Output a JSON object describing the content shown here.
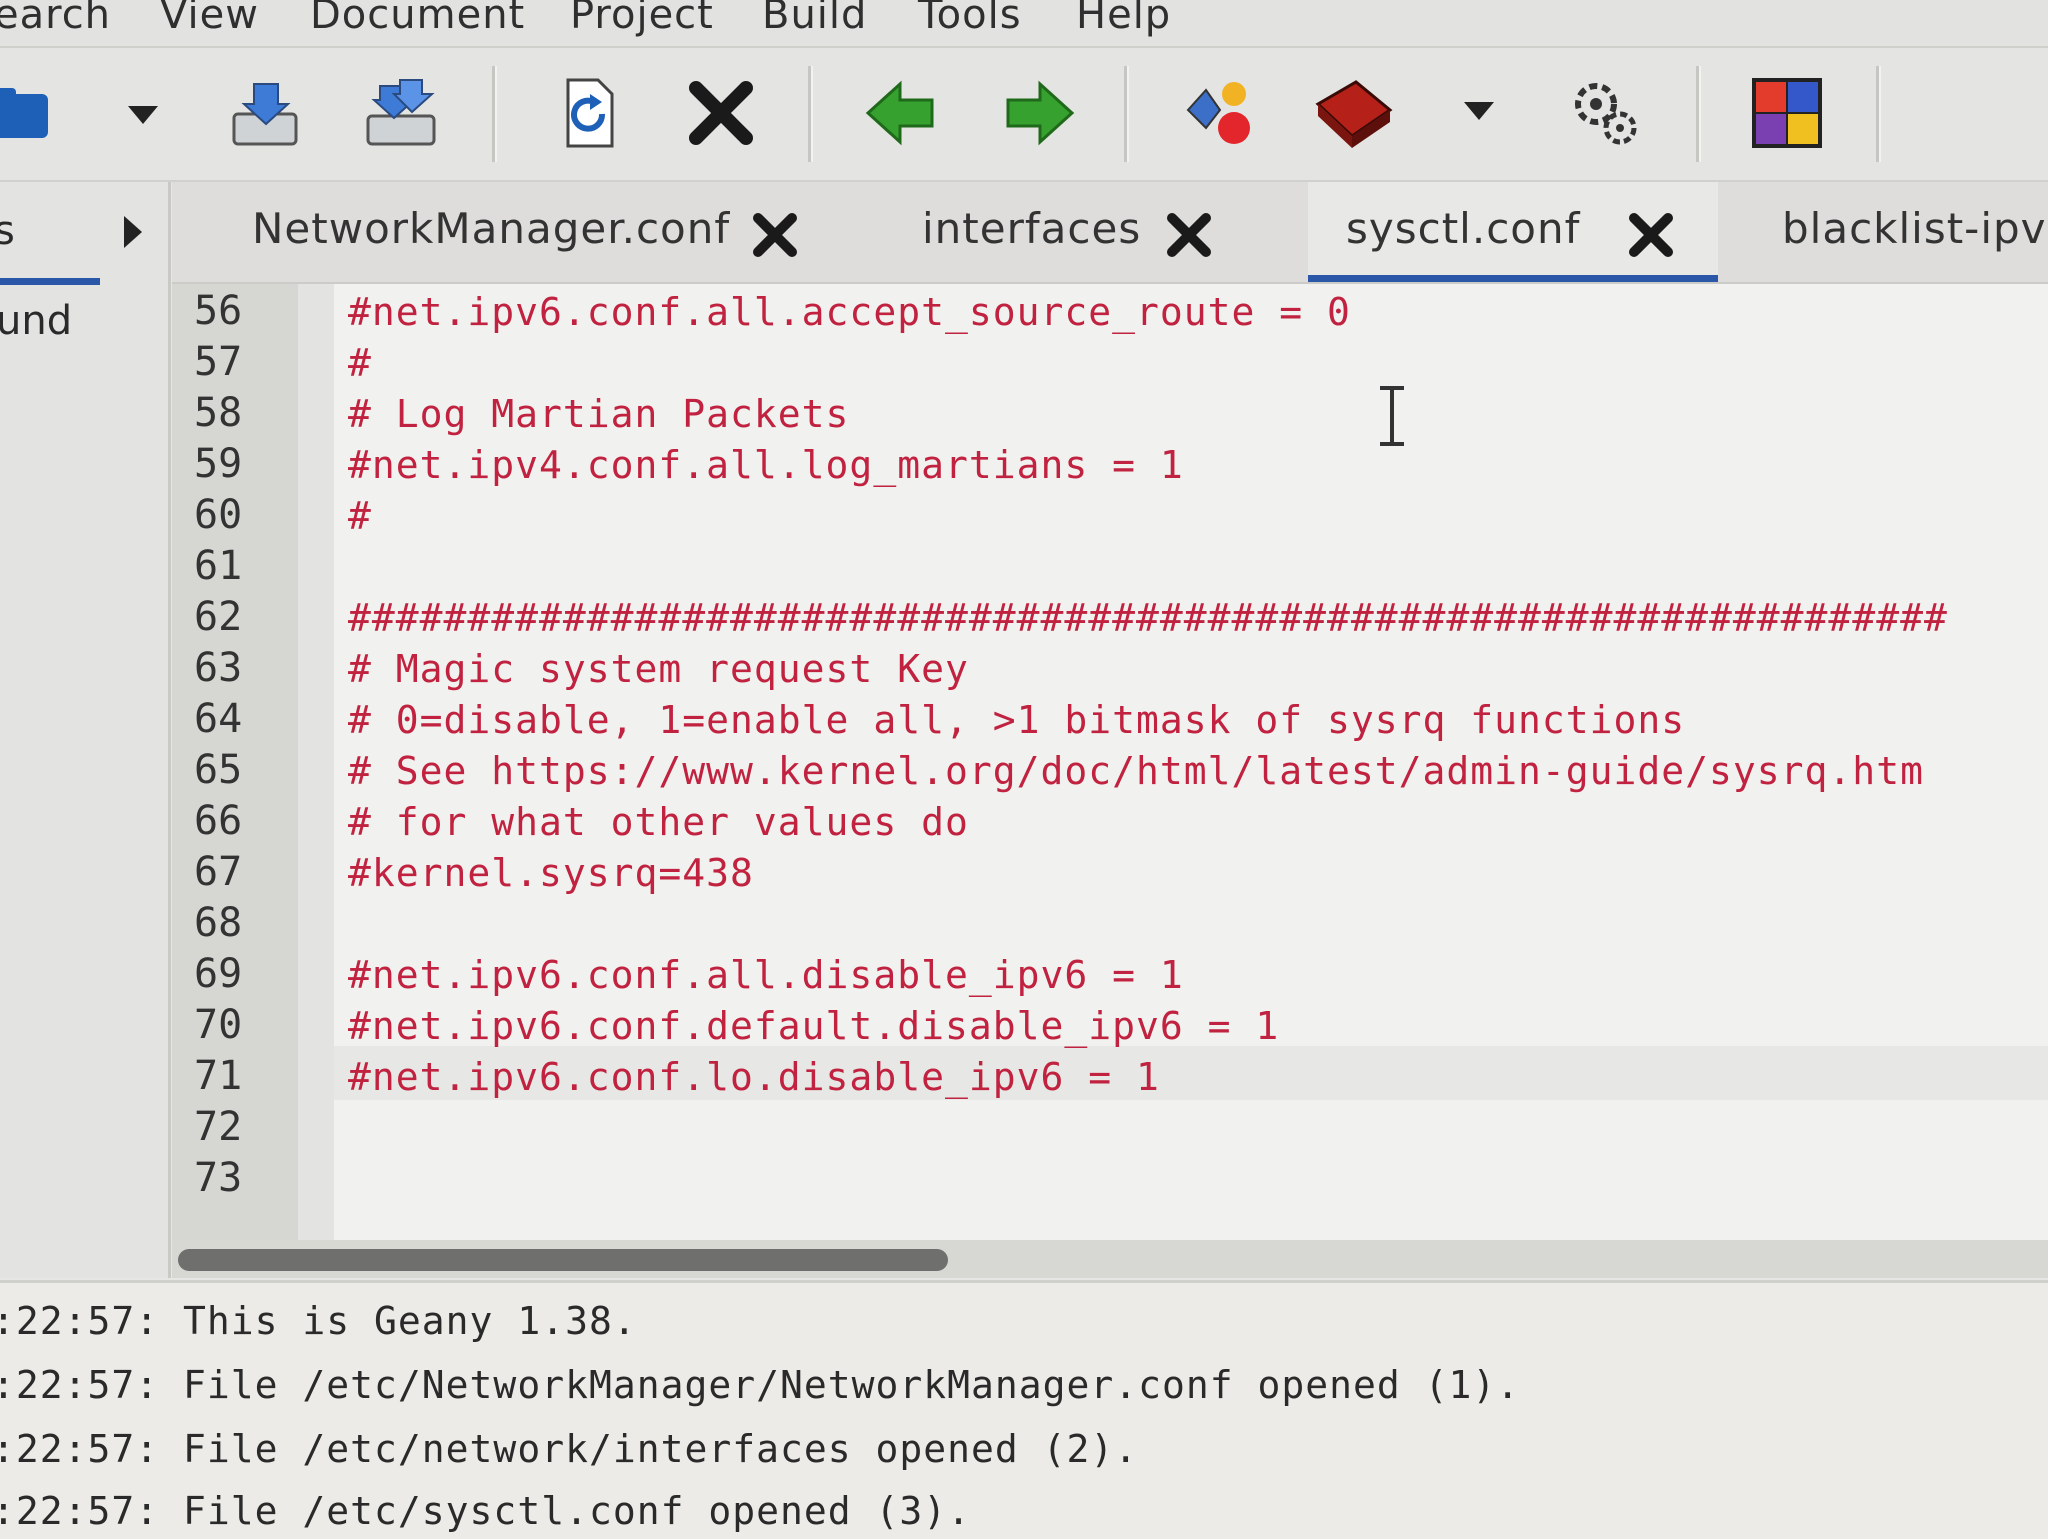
{
  "menubar": {
    "items": [
      "earch",
      "View",
      "Document",
      "Project",
      "Build",
      "Tools",
      "Help"
    ]
  },
  "toolbar": {
    "buttons": [
      {
        "name": "open-icon"
      },
      {
        "name": "dropdown-icon"
      },
      {
        "name": "save-icon"
      },
      {
        "name": "save-all-icon"
      },
      {
        "name": "reload-icon"
      },
      {
        "name": "close-icon"
      },
      {
        "name": "back-icon"
      },
      {
        "name": "forward-icon"
      },
      {
        "name": "compile-icon"
      },
      {
        "name": "build-icon"
      },
      {
        "name": "build-dropdown-icon"
      },
      {
        "name": "execute-icon"
      },
      {
        "name": "color-chooser-icon"
      }
    ]
  },
  "sidebar": {
    "tab_label": "s",
    "item": "und"
  },
  "tabs": [
    {
      "label": "NetworkManager.conf",
      "active": false
    },
    {
      "label": "interfaces",
      "active": false
    },
    {
      "label": "sysctl.conf",
      "active": true
    },
    {
      "label": "blacklist-ipv",
      "active": false
    }
  ],
  "editor": {
    "lines": [
      {
        "no": "56",
        "text": "#net.ipv6.conf.all.accept_source_route = 0"
      },
      {
        "no": "57",
        "text": "#"
      },
      {
        "no": "58",
        "text": "# Log Martian Packets"
      },
      {
        "no": "59",
        "text": "#net.ipv4.conf.all.log_martians = 1"
      },
      {
        "no": "60",
        "text": "#"
      },
      {
        "no": "61",
        "text": ""
      },
      {
        "no": "62",
        "text": "###################################################################"
      },
      {
        "no": "63",
        "text": "# Magic system request Key"
      },
      {
        "no": "64",
        "text": "# 0=disable, 1=enable all, >1 bitmask of sysrq functions"
      },
      {
        "no": "65",
        "text": "# See https://www.kernel.org/doc/html/latest/admin-guide/sysrq.htm"
      },
      {
        "no": "66",
        "text": "# for what other values do"
      },
      {
        "no": "67",
        "text": "#kernel.sysrq=438"
      },
      {
        "no": "68",
        "text": ""
      },
      {
        "no": "69",
        "text": "#net.ipv6.conf.all.disable_ipv6 = 1"
      },
      {
        "no": "70",
        "text": "#net.ipv6.conf.default.disable_ipv6 = 1"
      },
      {
        "no": "71",
        "text": "#net.ipv6.conf.lo.disable_ipv6 = 1"
      },
      {
        "no": "72",
        "text": ""
      },
      {
        "no": "73",
        "text": ""
      }
    ],
    "text_color": "#c0223f"
  },
  "messages": {
    "lines": [
      ":22:57: This is Geany 1.38.",
      ":22:57: File /etc/NetworkManager/NetworkManager.conf opened (1).",
      ":22:57: File /etc/network/interfaces opened (2).",
      ":22:57: File /etc/sysctl.conf opened (3)."
    ]
  },
  "colors": {
    "accent": "#2a57a8",
    "code": "#c0223f"
  }
}
